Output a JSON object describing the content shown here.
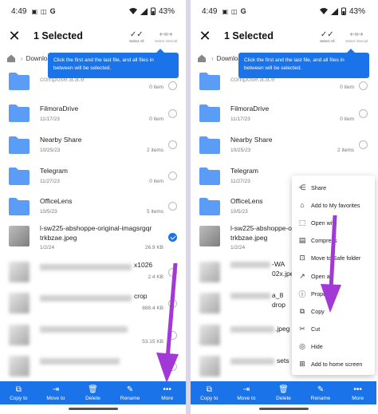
{
  "status": {
    "time": "4:49",
    "battery": "43%"
  },
  "header": {
    "title": "1 Selected",
    "select_all": "Select All",
    "select_interval": "Select interval"
  },
  "breadcrumb": {
    "folder": "Downloa"
  },
  "tooltip": {
    "text": "Click the first and the last file, and all files in between will be selected."
  },
  "files": [
    {
      "name": "compose.a.a.e",
      "date": "",
      "meta": "0 item",
      "kind": "folder",
      "checked": false
    },
    {
      "name": "FilmoraDrive",
      "date": "11/17/23",
      "meta": "0 item",
      "kind": "folder",
      "checked": false
    },
    {
      "name": "Nearby Share",
      "date": "10/25/23",
      "meta": "2 items",
      "kind": "folder",
      "checked": false
    },
    {
      "name": "Telegram",
      "date": "11/27/23",
      "meta": "0 item",
      "kind": "folder",
      "checked": false
    },
    {
      "name": "OfficeLens",
      "date": "10/5/23",
      "meta": "5 items",
      "kind": "folder",
      "checked": false
    },
    {
      "name": "l-sw225-abshoppe-original-imagsrgqrtrkbzae.jpeg",
      "name_line1": "l-sw225-abshoppe-original-imagsrgqr",
      "name_line2": "trkbzae.jpeg",
      "date": "1/2/24",
      "meta": "26.9 KB",
      "kind": "image",
      "checked": true
    },
    {
      "name": "x1026",
      "date": "",
      "meta": "2.4 KB",
      "kind": "blur",
      "checked": false
    },
    {
      "name": "crop",
      "date": "",
      "meta": "888.4 KB",
      "kind": "blur",
      "checked": false
    },
    {
      "name": "",
      "date": "",
      "meta": "53.15 KB",
      "kind": "blur",
      "checked": false
    },
    {
      "name": "",
      "date": "",
      "meta": "",
      "kind": "blur",
      "checked": false
    }
  ],
  "right_files": [
    {
      "name": "compose.a.a.e",
      "date": "",
      "meta": "0 item",
      "kind": "folder"
    },
    {
      "name": "FilmoraDrive",
      "date": "11/17/23",
      "meta": "0 item",
      "kind": "folder"
    },
    {
      "name": "Nearby Share",
      "date": "10/25/23",
      "meta": "2 items",
      "kind": "folder"
    },
    {
      "name": "Telegram",
      "date": "11/27/23",
      "meta": "",
      "kind": "folder"
    },
    {
      "name": "OfficeLens",
      "date": "10/5/23",
      "meta": "",
      "kind": "folder"
    },
    {
      "name": "l-sw225-abshoppe-original-imagsrgqrtrkbzae.jpeg",
      "name_line1": "l-sw225-abshoppe-original-imagsrgqr",
      "name_line2": "trkbzae.jpeg",
      "date": "1/2/24",
      "meta": "",
      "kind": "image"
    },
    {
      "name": "-WA",
      "name_line2": "02x.jpeg",
      "date": "",
      "meta": "",
      "kind": "blur"
    },
    {
      "name": "a_8",
      "name_line2": "drop",
      "date": "",
      "meta": "",
      "kind": "blur"
    },
    {
      "name": ".jpeg",
      "date": "",
      "meta": "",
      "kind": "blur"
    },
    {
      "name": "sets",
      "date": "",
      "meta": "",
      "kind": "blur"
    }
  ],
  "bottombar": {
    "copy_to": "Copy to",
    "move_to": "Move to",
    "delete": "Delete",
    "rename": "Rename",
    "more": "More"
  },
  "menu": {
    "items": [
      {
        "icon": "share-icon",
        "label": "Share"
      },
      {
        "icon": "home-icon",
        "label": "Add to My favorites"
      },
      {
        "icon": "open-with-icon",
        "label": "Open with"
      },
      {
        "icon": "compress-icon",
        "label": "Compress"
      },
      {
        "icon": "safe-folder-icon",
        "label": "Move to Safe folder"
      },
      {
        "icon": "open-as-icon",
        "label": "Open as"
      },
      {
        "icon": "info-icon",
        "label": "Properties"
      },
      {
        "icon": "copy-icon",
        "label": "Copy"
      },
      {
        "icon": "cut-icon",
        "label": "Cut"
      },
      {
        "icon": "hide-icon",
        "label": "Hide"
      },
      {
        "icon": "home-screen-icon",
        "label": "Add to home screen"
      }
    ]
  },
  "colors": {
    "accent": "#1a73e8",
    "folder": "#5b9cf6",
    "arrow": "#a238d6"
  }
}
